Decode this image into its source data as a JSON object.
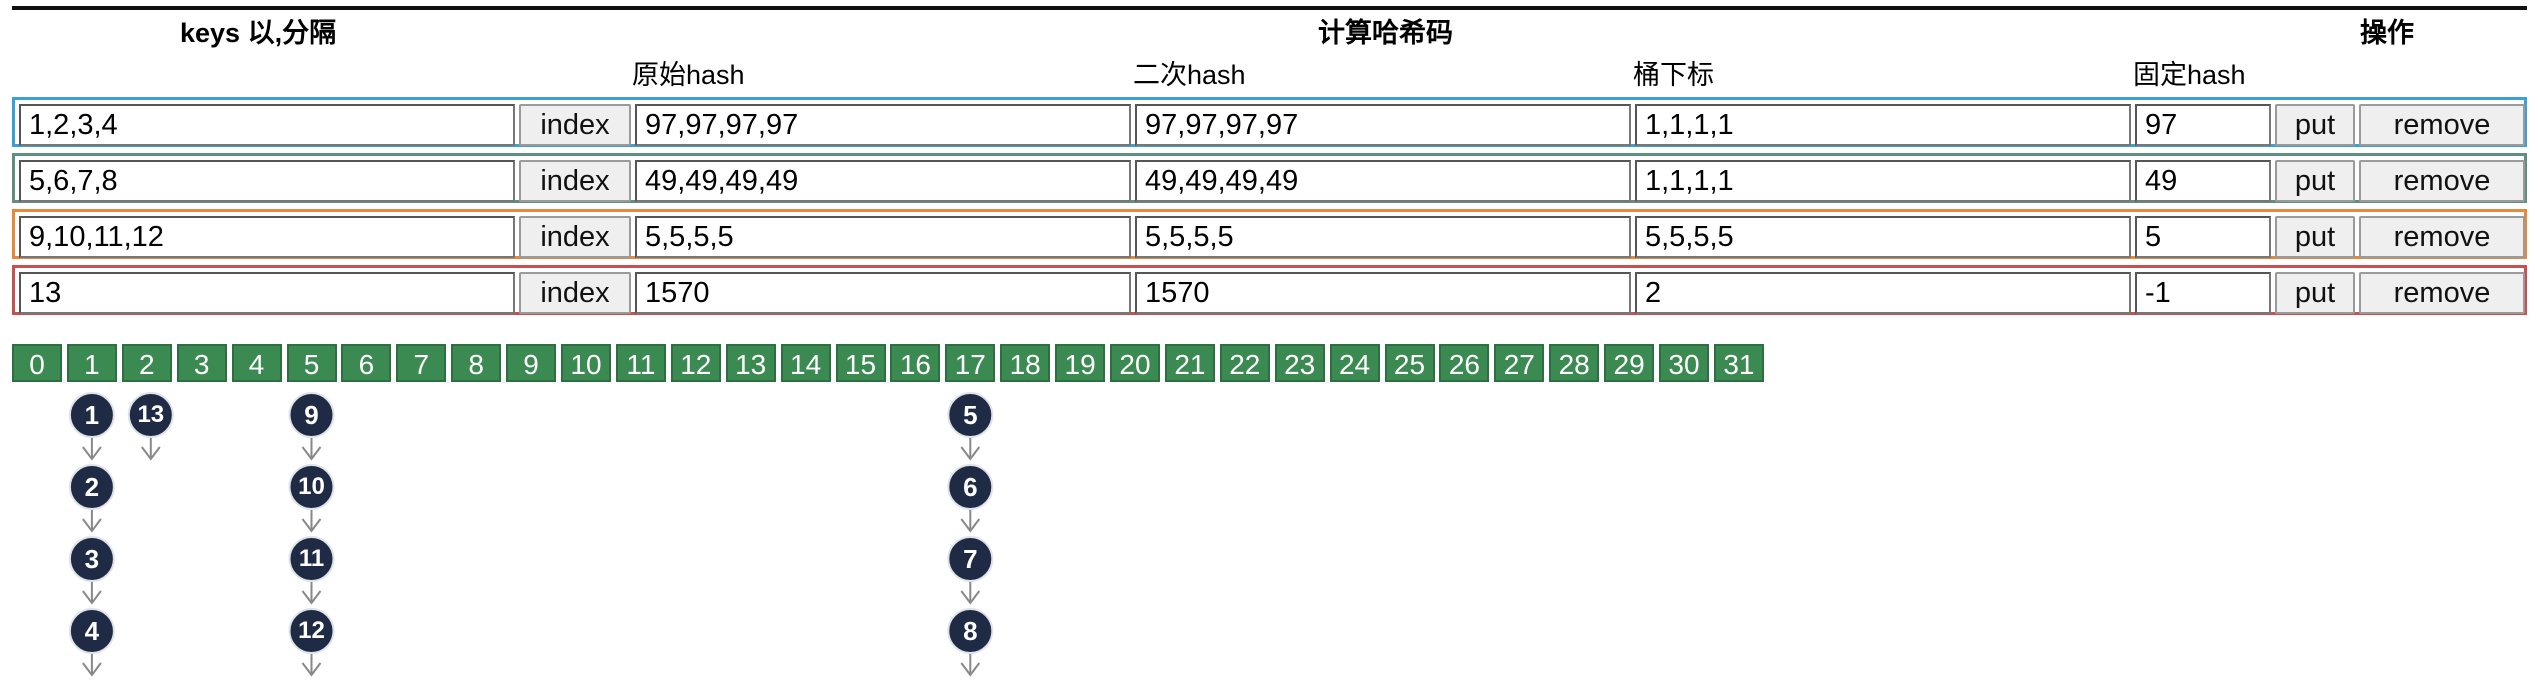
{
  "headers": {
    "keys": "keys 以,分隔",
    "compute": "计算哈希码",
    "ops": "操作"
  },
  "subheaders": {
    "raw_hash": "原始hash",
    "second_hash": "二次hash",
    "bucket_index": "桶下标",
    "fixed_hash": "固定hash"
  },
  "rows": [
    {
      "keys": "1,2,3,4",
      "index_label": "index",
      "raw_hash": "97,97,97,97",
      "second_hash": "97,97,97,97",
      "bucket": "1,1,1,1",
      "fixed": "97",
      "put_label": "put",
      "remove_label": "remove",
      "color": "#3aa0d8"
    },
    {
      "keys": "5,6,7,8",
      "index_label": "index",
      "raw_hash": "49,49,49,49",
      "second_hash": "49,49,49,49",
      "bucket": "1,1,1,1",
      "fixed": "49",
      "put_label": "put",
      "remove_label": "remove",
      "color": "#5f8f80"
    },
    {
      "keys": "9,10,11,12",
      "index_label": "index",
      "raw_hash": "5,5,5,5",
      "second_hash": "5,5,5,5",
      "bucket": "5,5,5,5",
      "fixed": "5",
      "put_label": "put",
      "remove_label": "remove",
      "color": "#e8893a"
    },
    {
      "keys": "13",
      "index_label": "index",
      "raw_hash": "1570",
      "second_hash": "1570",
      "bucket": "2",
      "fixed": "-1",
      "put_label": "put",
      "remove_label": "remove",
      "color": "#c8504f"
    }
  ],
  "buckets": [
    "0",
    "1",
    "2",
    "3",
    "4",
    "5",
    "6",
    "7",
    "8",
    "9",
    "10",
    "11",
    "12",
    "13",
    "14",
    "15",
    "16",
    "17",
    "18",
    "19",
    "20",
    "21",
    "22",
    "23",
    "24",
    "25",
    "26",
    "27",
    "28",
    "29",
    "30",
    "31"
  ],
  "chains": [
    {
      "bucket": 1,
      "nodes": [
        "1",
        "2",
        "3",
        "4"
      ]
    },
    {
      "bucket": 2,
      "nodes": [
        "13"
      ]
    },
    {
      "bucket": 5,
      "nodes": [
        "9",
        "10",
        "11",
        "12"
      ]
    },
    {
      "bucket": 17,
      "nodes": [
        "5",
        "6",
        "7",
        "8"
      ]
    }
  ],
  "colors": {
    "bucket": "#3b8a52",
    "node": "#1f2a44",
    "arrow": "#888888"
  }
}
